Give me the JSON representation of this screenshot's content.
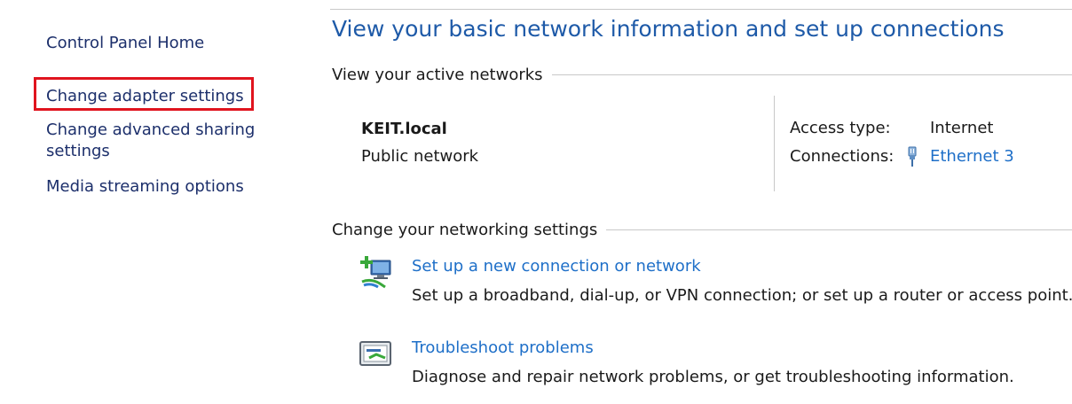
{
  "left_nav": {
    "items": [
      {
        "label": "Control Panel Home"
      },
      {
        "label": "Change adapter settings",
        "highlighted": true
      },
      {
        "label": "Change advanced sharing settings"
      },
      {
        "label": "Media streaming options"
      }
    ]
  },
  "main": {
    "title": "View your basic network information and set up connections",
    "active_networks": {
      "heading": "View your active networks",
      "network_name": "KEIT.local",
      "network_type": "Public network",
      "access_type_label": "Access type:",
      "access_type_value": "Internet",
      "connections_label": "Connections:",
      "connections_value": "Ethernet 3",
      "connections_icon": "ethernet-icon"
    },
    "networking_settings": {
      "heading": "Change your networking settings",
      "tasks": [
        {
          "icon": "new-connection-icon",
          "link": "Set up a new connection or network",
          "description": "Set up a broadband, dial-up, or VPN connection; or set up a router or access point."
        },
        {
          "icon": "troubleshoot-icon",
          "link": "Troubleshoot problems",
          "description": "Diagnose and repair network problems, or get troubleshooting information."
        }
      ]
    }
  },
  "colors": {
    "title_blue": "#1e5aa8",
    "link_blue": "#1e6fc8",
    "nav_text": "#1c2f6b",
    "highlight_red": "#e0141e"
  }
}
